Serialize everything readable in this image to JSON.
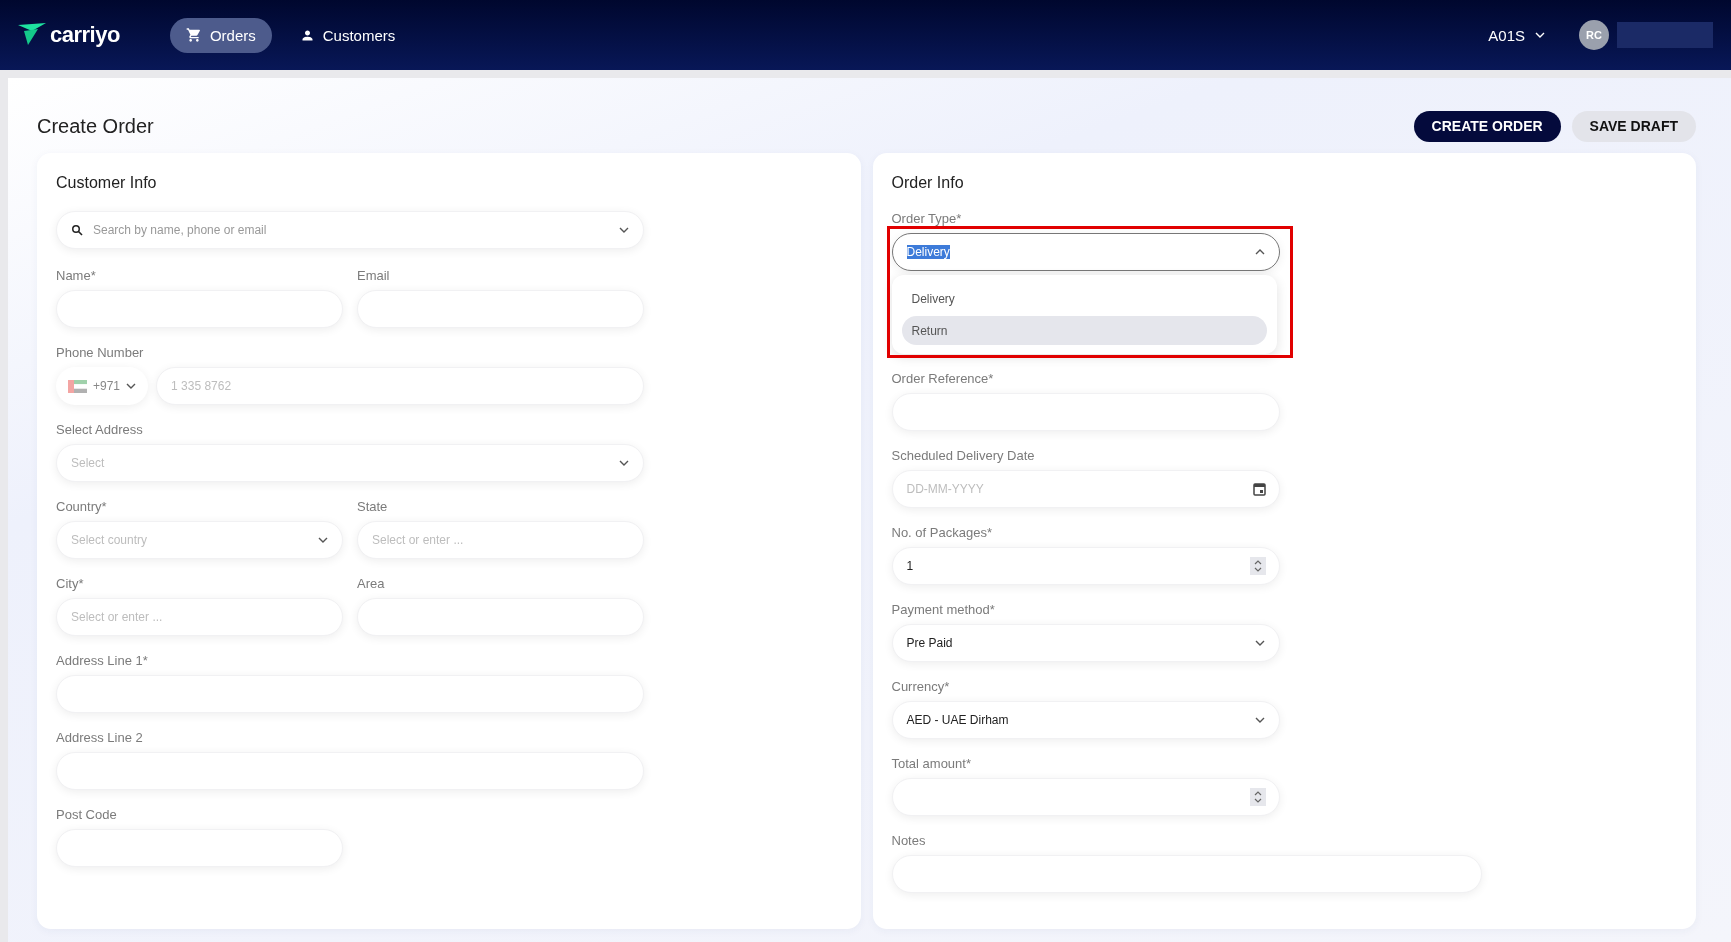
{
  "header": {
    "logo": "carriyo",
    "nav": [
      {
        "label": "Orders",
        "selected": true
      },
      {
        "label": "Customers",
        "selected": false
      }
    ],
    "account": "A01S",
    "avatar_initials": "RC"
  },
  "page_title": "Create Order",
  "actions": [
    {
      "label": "CREATE ORDER",
      "kind": "primary"
    },
    {
      "label": "SAVE DRAFT",
      "kind": "secondary"
    }
  ],
  "customer_info": {
    "title": "Customer Info",
    "fields": [
      {
        "kind": "search",
        "placeholder": "Search by name, phone or email",
        "wide": true
      },
      {
        "kind": "text",
        "label": "Name*",
        "wide": false
      },
      {
        "kind": "text",
        "label": "Email",
        "wide": false
      },
      {
        "kind": "phone",
        "label": "Phone Number",
        "dial_code": "+971",
        "placeholder": "1 335 8762",
        "wide": true
      },
      {
        "kind": "select",
        "label": "Select Address",
        "placeholder": "Select",
        "wide": true
      },
      {
        "kind": "select",
        "label": "Country*",
        "placeholder": "Select country",
        "wide": false
      },
      {
        "kind": "text",
        "label": "State",
        "placeholder": "Select or enter ...",
        "wide": false
      },
      {
        "kind": "text",
        "label": "City*",
        "placeholder": "Select or enter ...",
        "wide": false
      },
      {
        "kind": "text",
        "label": "Area",
        "wide": false
      },
      {
        "kind": "text",
        "label": "Address Line 1*",
        "wide": true
      },
      {
        "kind": "text",
        "label": "Address Line 2",
        "wide": true
      },
      {
        "kind": "text",
        "label": "Post Code",
        "wide": false
      }
    ]
  },
  "order_info": {
    "title": "Order Info",
    "fields": [
      {
        "kind": "select",
        "label": "Order Type*",
        "value": "Delivery",
        "value_text_selected": true,
        "expanded": true,
        "highlighted": true,
        "wide": false,
        "options": [
          {
            "label": "Delivery",
            "highlighted": false
          },
          {
            "label": "Return",
            "highlighted": true
          }
        ]
      },
      {
        "kind": "text",
        "label": "Order Reference*",
        "wide": false
      },
      {
        "kind": "date",
        "label": "Scheduled Delivery Date",
        "placeholder": "DD-MM-YYYY",
        "wide": false
      },
      {
        "kind": "number",
        "label": "No. of Packages*",
        "value": "1",
        "wide": false
      },
      {
        "kind": "select",
        "label": "Payment method*",
        "value": "Pre Paid",
        "wide": false
      },
      {
        "kind": "select",
        "label": "Currency*",
        "value": "AED - UAE Dirham",
        "wide": false
      },
      {
        "kind": "number",
        "label": "Total amount*",
        "wide": false
      },
      {
        "kind": "text",
        "label": "Notes",
        "wide": true
      }
    ]
  }
}
